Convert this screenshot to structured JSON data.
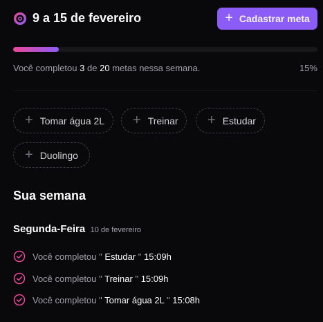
{
  "header": {
    "week_title": "9 a 15 de fevereiro",
    "create_button_label": "Cadastrar meta"
  },
  "progress": {
    "text_prefix": "Você completou",
    "completed": "3",
    "text_middle": "de",
    "total": "20",
    "text_suffix": "metas nessa semana.",
    "percent_label": "15%",
    "fraction": 0.15
  },
  "pending_goals": [
    {
      "label": "Tomar água 2L"
    },
    {
      "label": "Treinar"
    },
    {
      "label": "Estudar"
    },
    {
      "label": "Duolingo"
    }
  ],
  "summary": {
    "section_title": "Sua semana",
    "day_name": "Segunda-Feira",
    "day_date": "10 de fevereiro",
    "entry_prefix": "Você completou \"",
    "entry_suffix": "\"",
    "entries": [
      {
        "goal": "Estudar",
        "time": "15:09h"
      },
      {
        "goal": "Treinar",
        "time": "15:09h"
      },
      {
        "goal": "Tomar água 2L",
        "time": "15:08h"
      }
    ]
  },
  "colors": {
    "background": "#09090b",
    "accent": "#8b5cf6",
    "accent_pink": "#ec4899",
    "muted_text": "#a1a1aa"
  },
  "icons": {
    "logo": "in-orbit-logo-icon",
    "add": "plus-icon",
    "completed": "check-circle-icon"
  }
}
